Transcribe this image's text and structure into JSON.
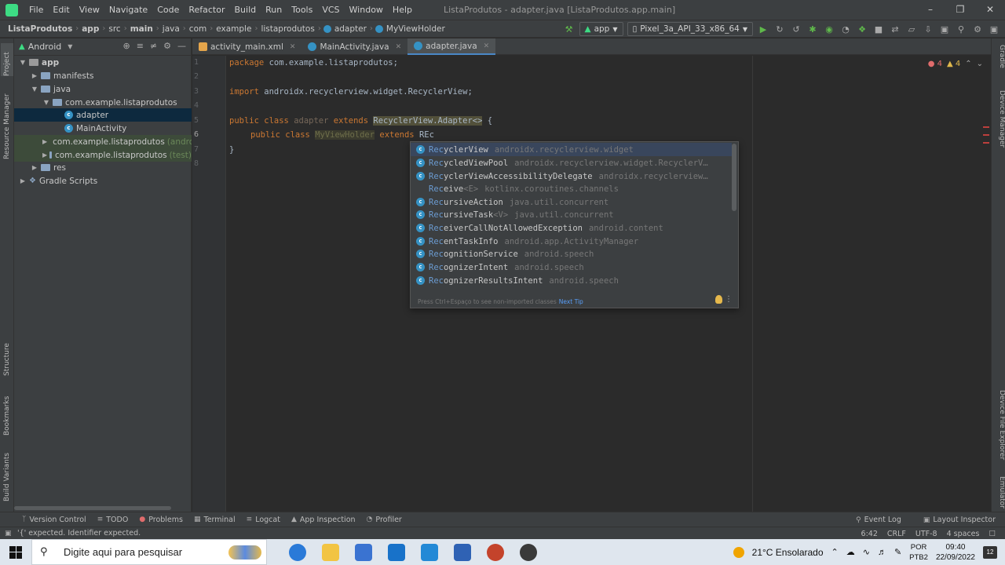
{
  "window": {
    "menu": [
      "File",
      "Edit",
      "View",
      "Navigate",
      "Code",
      "Refactor",
      "Build",
      "Run",
      "Tools",
      "VCS",
      "Window",
      "Help"
    ],
    "title": "ListaProdutos - adapter.java [ListaProdutos.app.main]"
  },
  "breadcrumb": [
    "ListaProdutos",
    "app",
    "src",
    "main",
    "java",
    "com",
    "example",
    "listaprodutos",
    "adapter",
    "MyViewHolder"
  ],
  "toolbar": {
    "run_config": "app",
    "device": "Pixel_3a_API_33_x86_64"
  },
  "left_stripe": [
    "Project",
    "Resource Manager",
    "Structure",
    "Bookmarks",
    "Build Variants"
  ],
  "right_stripe": [
    "Gradle",
    "Device Manager",
    "Device File Explorer",
    "Emulator"
  ],
  "project_panel": {
    "view": "Android",
    "tree": [
      {
        "label": "app",
        "note": ""
      },
      {
        "label": "manifests",
        "note": ""
      },
      {
        "label": "java",
        "note": ""
      },
      {
        "label": "com.example.listaprodutos",
        "note": ""
      },
      {
        "label": "adapter",
        "note": ""
      },
      {
        "label": "MainActivity",
        "note": ""
      },
      {
        "label": "com.example.listaprodutos",
        "note": "(android"
      },
      {
        "label": "com.example.listaprodutos",
        "note": "(test)"
      },
      {
        "label": "res",
        "note": ""
      },
      {
        "label": "Gradle Scripts",
        "note": ""
      }
    ]
  },
  "tabs": [
    {
      "label": "activity_main.xml"
    },
    {
      "label": "MainActivity.java"
    },
    {
      "label": "adapter.java"
    }
  ],
  "editor": {
    "line_numbers": [
      "1",
      "2",
      "3",
      "4",
      "5",
      "6",
      "7",
      "8"
    ],
    "line1_kw": "package",
    "line1_rest": " com.example.listaprodutos;",
    "line3_kw": "import",
    "line3_rest": " androidx.recyclerview.widget.RecyclerView;",
    "line5_kw1": "public class",
    "line5_name": "adapter",
    "line5_kw2": "extends",
    "line5_type": "RecyclerView.Adapter<>",
    "line5_brace": " {",
    "line6_kw1": "public class",
    "line6_name": "MyViewHolder",
    "line6_kw2": "extends",
    "line6_typed": "REc",
    "line7": "}",
    "errors": "4",
    "warnings": "4"
  },
  "completion": {
    "items": [
      {
        "icon": "C",
        "match": "Rec",
        "name": "yclerView",
        "generic": "",
        "pkg": "androidx.recyclerview.widget"
      },
      {
        "icon": "C",
        "match": "Rec",
        "name": "ycledViewPool",
        "generic": "",
        "pkg": "androidx.recyclerview.widget.RecyclerV…"
      },
      {
        "icon": "C",
        "match": "Rec",
        "name": "yclerViewAccessibilityDelegate",
        "generic": "",
        "pkg": "androidx.recyclerview…"
      },
      {
        "icon": "",
        "match": "Rec",
        "name": "eive",
        "generic": "<E>",
        "pkg": "kotlinx.coroutines.channels"
      },
      {
        "icon": "C",
        "match": "Rec",
        "name": "ursiveAction",
        "generic": "",
        "pkg": "java.util.concurrent"
      },
      {
        "icon": "C",
        "match": "Rec",
        "name": "ursiveTask",
        "generic": "<V>",
        "pkg": "java.util.concurrent"
      },
      {
        "icon": "C",
        "match": "Rec",
        "name": "eiverCallNotAllowedException",
        "generic": "",
        "pkg": "android.content"
      },
      {
        "icon": "C",
        "match": "Rec",
        "name": "entTaskInfo",
        "generic": "",
        "pkg": "android.app.ActivityManager"
      },
      {
        "icon": "C",
        "match": "Rec",
        "name": "ognitionService",
        "generic": "",
        "pkg": "android.speech"
      },
      {
        "icon": "C",
        "match": "Rec",
        "name": "ognizerIntent",
        "generic": "",
        "pkg": "android.speech"
      },
      {
        "icon": "C",
        "match": "Rec",
        "name": "ognizerResultsIntent",
        "generic": "",
        "pkg": "android.speech"
      }
    ],
    "footer": "Press Ctrl+Espaço to see non-imported classes",
    "next_tip": "Next Tip"
  },
  "bottom_tools": [
    "Version Control",
    "TODO",
    "Problems",
    "Terminal",
    "Logcat",
    "App Inspection",
    "Profiler"
  ],
  "bottom_right_tools": [
    "Event Log",
    "Layout Inspector"
  ],
  "status": {
    "message": "'{' expected. Identifier expected.",
    "position": "6:42",
    "line_sep": "CRLF",
    "encoding": "UTF-8",
    "indent": "4 spaces"
  },
  "taskbar": {
    "search_placeholder": "Digite aqui para pesquisar",
    "weather": "21°C  Ensolarado",
    "lang1": "POR",
    "lang2": "PTB2",
    "time": "09:40",
    "date": "22/09/2022",
    "notifications": "12"
  }
}
